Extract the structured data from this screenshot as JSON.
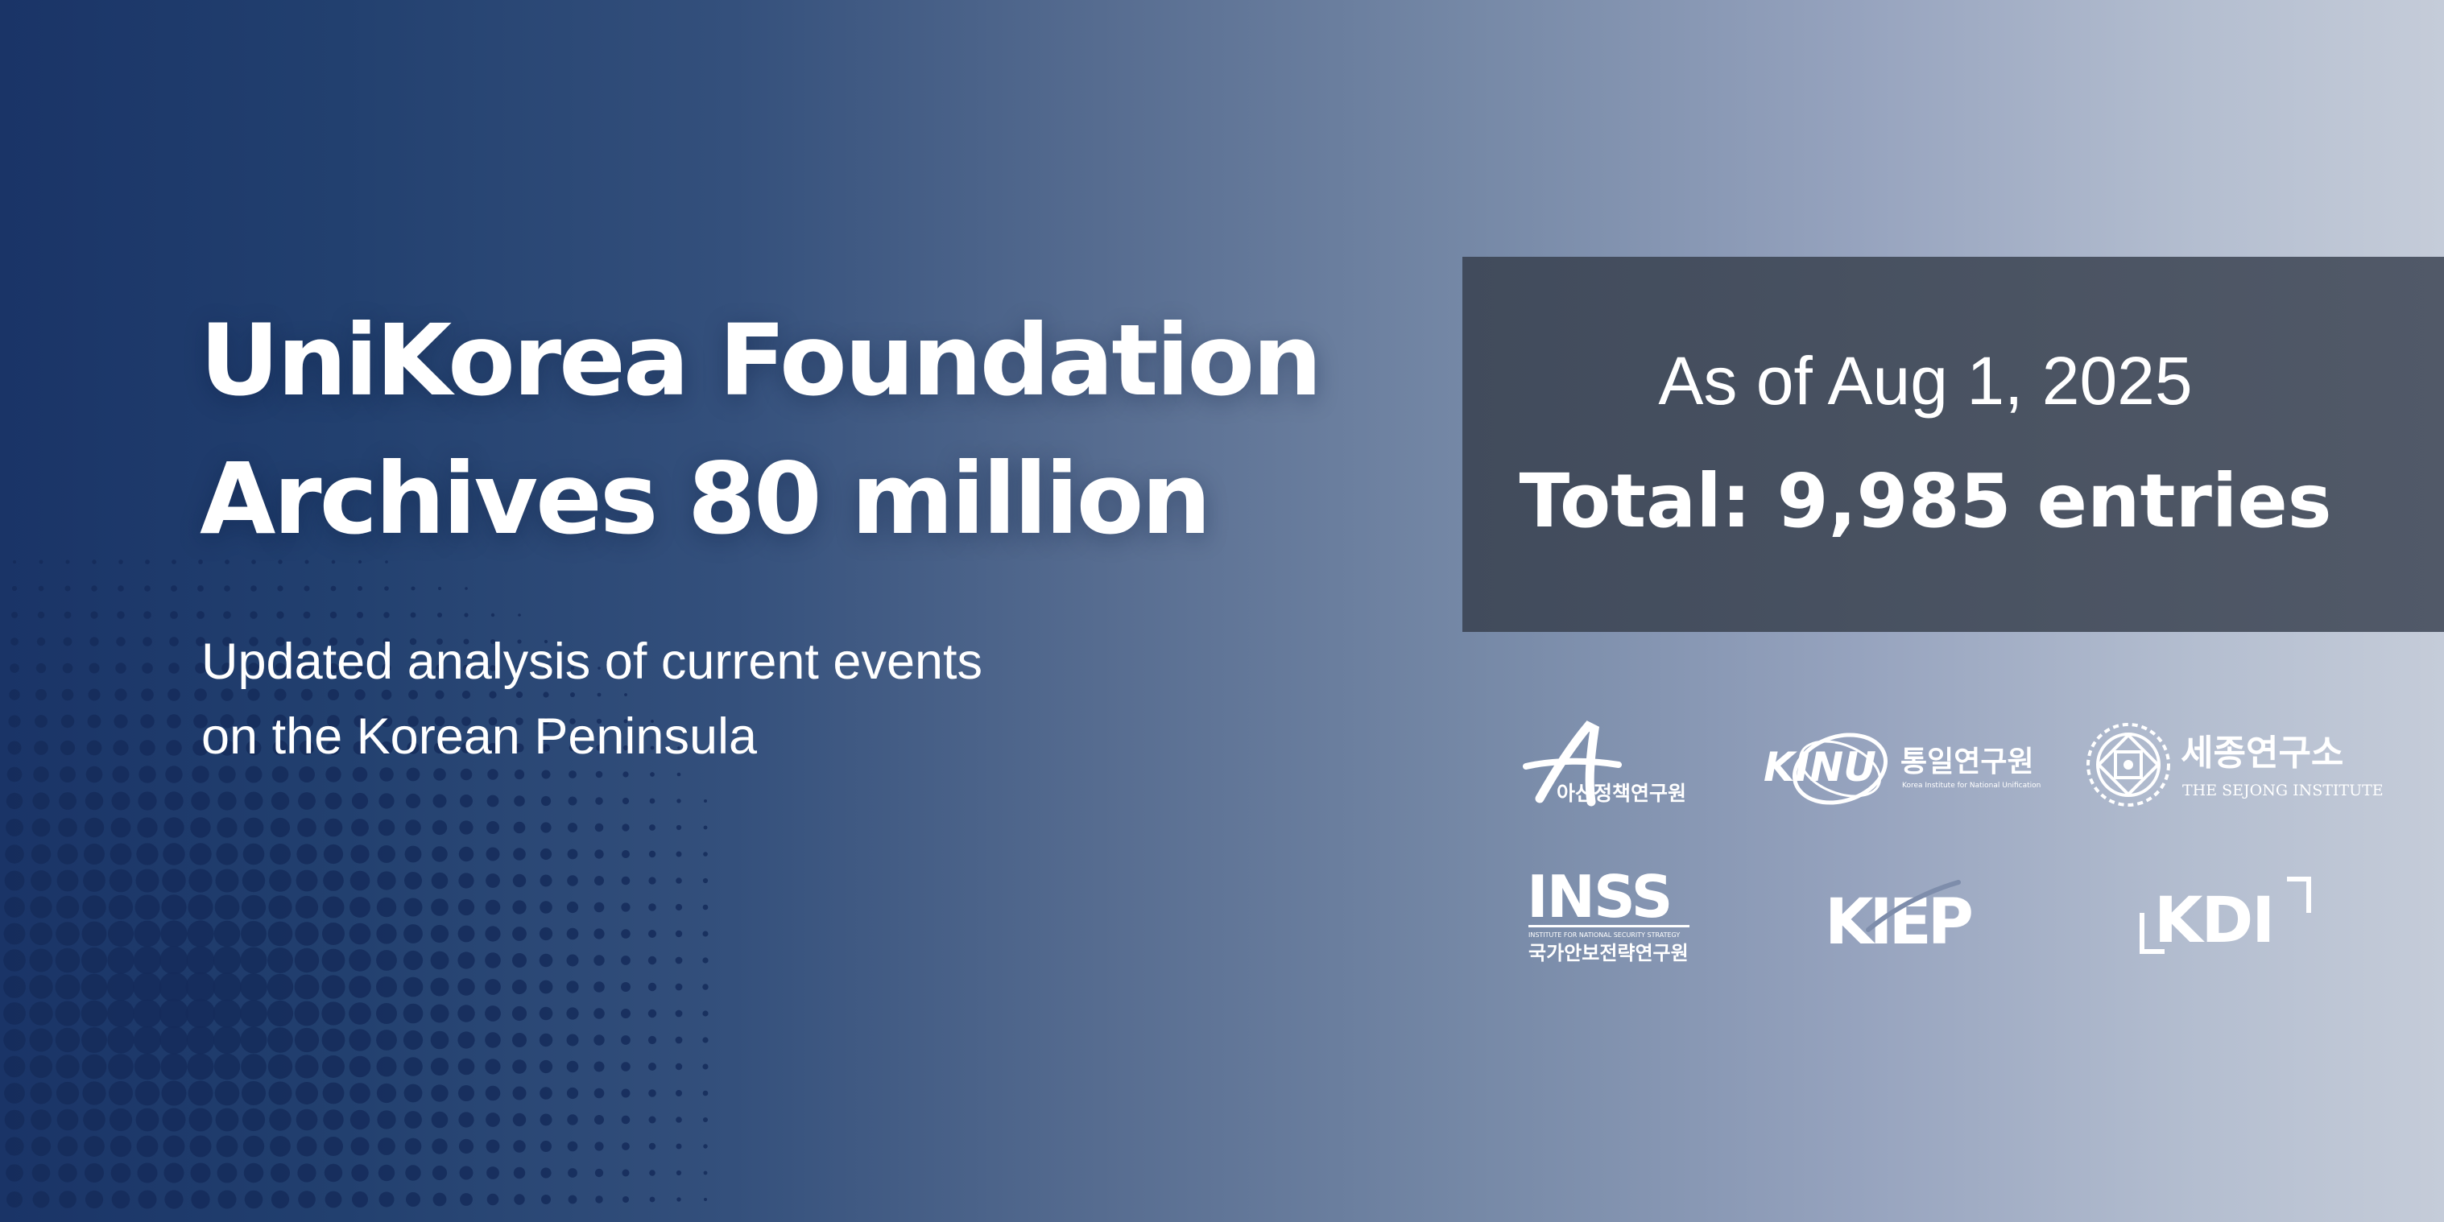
{
  "headline": {
    "line1": "UniKorea Foundation",
    "line2": "Archives 80 million"
  },
  "subheadline": {
    "line1": "Updated analysis of current events",
    "line2": "on the Korean Peninsula"
  },
  "stats": {
    "as_of": "As of Aug 1, 2025",
    "total": "Total: 9,985 entries"
  },
  "logos": {
    "asan": {
      "name": "아산정책연구원"
    },
    "kinu": {
      "mark": "KINU",
      "name": "통일연구원",
      "tagline": "Korea Institute for National Unification"
    },
    "sejong": {
      "name": "세종연구소",
      "tagline": "THE SEJONG INSTITUTE"
    },
    "inss": {
      "mark": "INSS",
      "tagline": "INSTITUTE FOR NATIONAL SECURITY STRATEGY",
      "name": "국가안보전략연구원"
    },
    "kiep": {
      "mark": "KIEP"
    },
    "kdi": {
      "mark": "KDI"
    }
  },
  "colors": {
    "gradient_left": "#1a3467",
    "gradient_right": "#c5ccd9",
    "stats_box": "#4a5362",
    "text": "#ffffff",
    "halftone_dot": "#152c5b"
  }
}
